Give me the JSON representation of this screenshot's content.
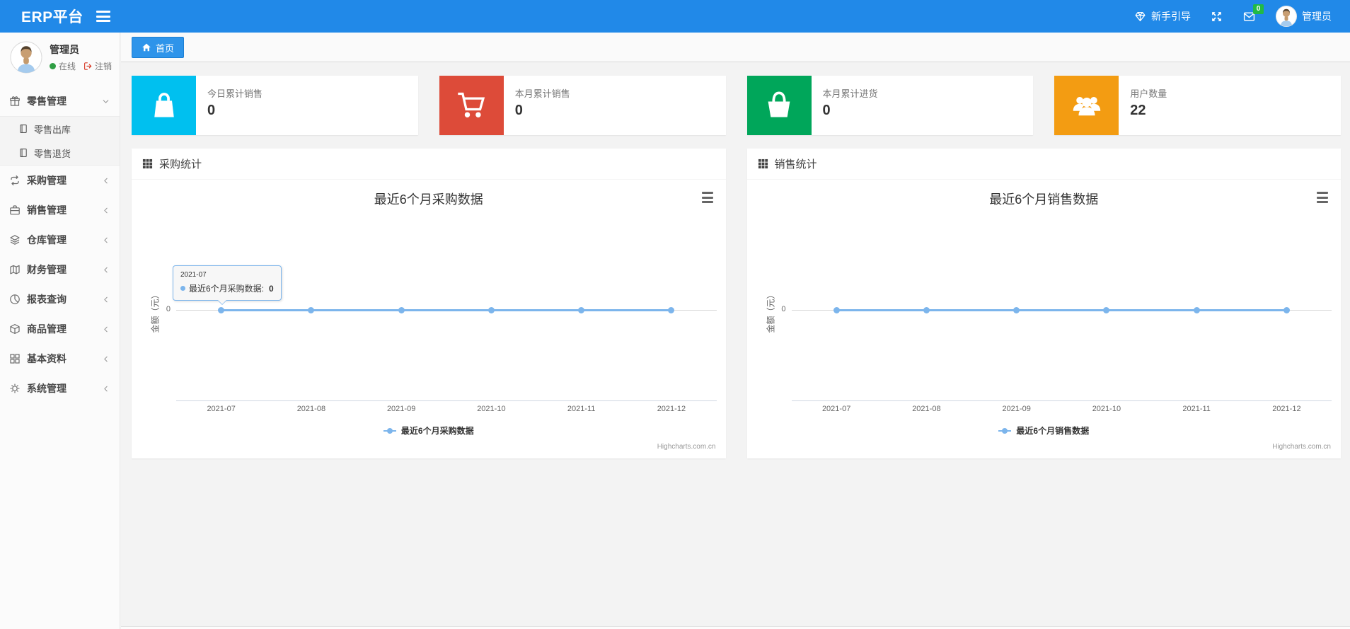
{
  "theme": {
    "navbar_color": "#2189e8",
    "content_bg": "#f3f3f3",
    "tab_active_color": "#2e94ea",
    "badge_color": "#21ba45",
    "online_dot_color": "#2f9e44",
    "logout_icon_color": "#d73925"
  },
  "navbar": {
    "brand": "ERP平台",
    "guide_label": "新手引导",
    "message_badge": "0",
    "username": "管理员"
  },
  "sidebar": {
    "user": {
      "name": "管理员",
      "status": "在线",
      "logout_label": "注销"
    },
    "menu": [
      {
        "label": "零售管理",
        "icon": "gift-icon",
        "expanded": true,
        "children": [
          {
            "label": "零售出库",
            "icon": "journal-icon"
          },
          {
            "label": "零售退货",
            "icon": "journal-icon"
          }
        ]
      },
      {
        "label": "采购管理",
        "icon": "repeat-icon"
      },
      {
        "label": "销售管理",
        "icon": "briefcase-icon"
      },
      {
        "label": "仓库管理",
        "icon": "layers-icon"
      },
      {
        "label": "财务管理",
        "icon": "map-book-icon"
      },
      {
        "label": "报表查询",
        "icon": "pie-chart-icon"
      },
      {
        "label": "商品管理",
        "icon": "box-icon"
      },
      {
        "label": "基本资料",
        "icon": "grid-icon"
      },
      {
        "label": "系统管理",
        "icon": "gear-icon"
      }
    ]
  },
  "tabs": {
    "home_label": "首页"
  },
  "stat_cards": [
    {
      "label": "今日累计销售",
      "value": "0",
      "color": "#00c0ef",
      "icon": "shopping-bag-icon"
    },
    {
      "label": "本月累计销售",
      "value": "0",
      "color": "#dd4b39",
      "icon": "shopping-cart-icon"
    },
    {
      "label": "本月累计进货",
      "value": "0",
      "color": "#00a65a",
      "icon": "shopping-basket-icon"
    },
    {
      "label": "用户数量",
      "value": "22",
      "color": "#f39c12",
      "icon": "users-icon"
    }
  ],
  "panels": [
    {
      "title": "采购统计"
    },
    {
      "title": "销售统计"
    }
  ],
  "chart_data": [
    {
      "type": "line",
      "title": "最近6个月采购数据",
      "categories": [
        "2021-07",
        "2021-08",
        "2021-09",
        "2021-10",
        "2021-11",
        "2021-12"
      ],
      "series": [
        {
          "name": "最近6个月采购数据",
          "values": [
            0,
            0,
            0,
            0,
            0,
            0
          ]
        }
      ],
      "xlabel": "",
      "ylabel": "金额（元）",
      "yticks": [
        "0"
      ],
      "ylim": [
        0,
        0
      ],
      "color": "#7cb5ec",
      "grid": true,
      "legend_position": "bottom",
      "credits": "Highcharts.com.cn",
      "tooltip": {
        "visible": true,
        "x_label": "2021-07",
        "series_label": "最近6个月采购数据:",
        "value": "0"
      }
    },
    {
      "type": "line",
      "title": "最近6个月销售数据",
      "categories": [
        "2021-07",
        "2021-08",
        "2021-09",
        "2021-10",
        "2021-11",
        "2021-12"
      ],
      "series": [
        {
          "name": "最近6个月销售数据",
          "values": [
            0,
            0,
            0,
            0,
            0,
            0
          ]
        }
      ],
      "xlabel": "",
      "ylabel": "金额（元）",
      "yticks": [
        "0"
      ],
      "ylim": [
        0,
        0
      ],
      "color": "#7cb5ec",
      "grid": true,
      "legend_position": "bottom",
      "credits": "Highcharts.com.cn",
      "tooltip": {
        "visible": false
      }
    }
  ]
}
